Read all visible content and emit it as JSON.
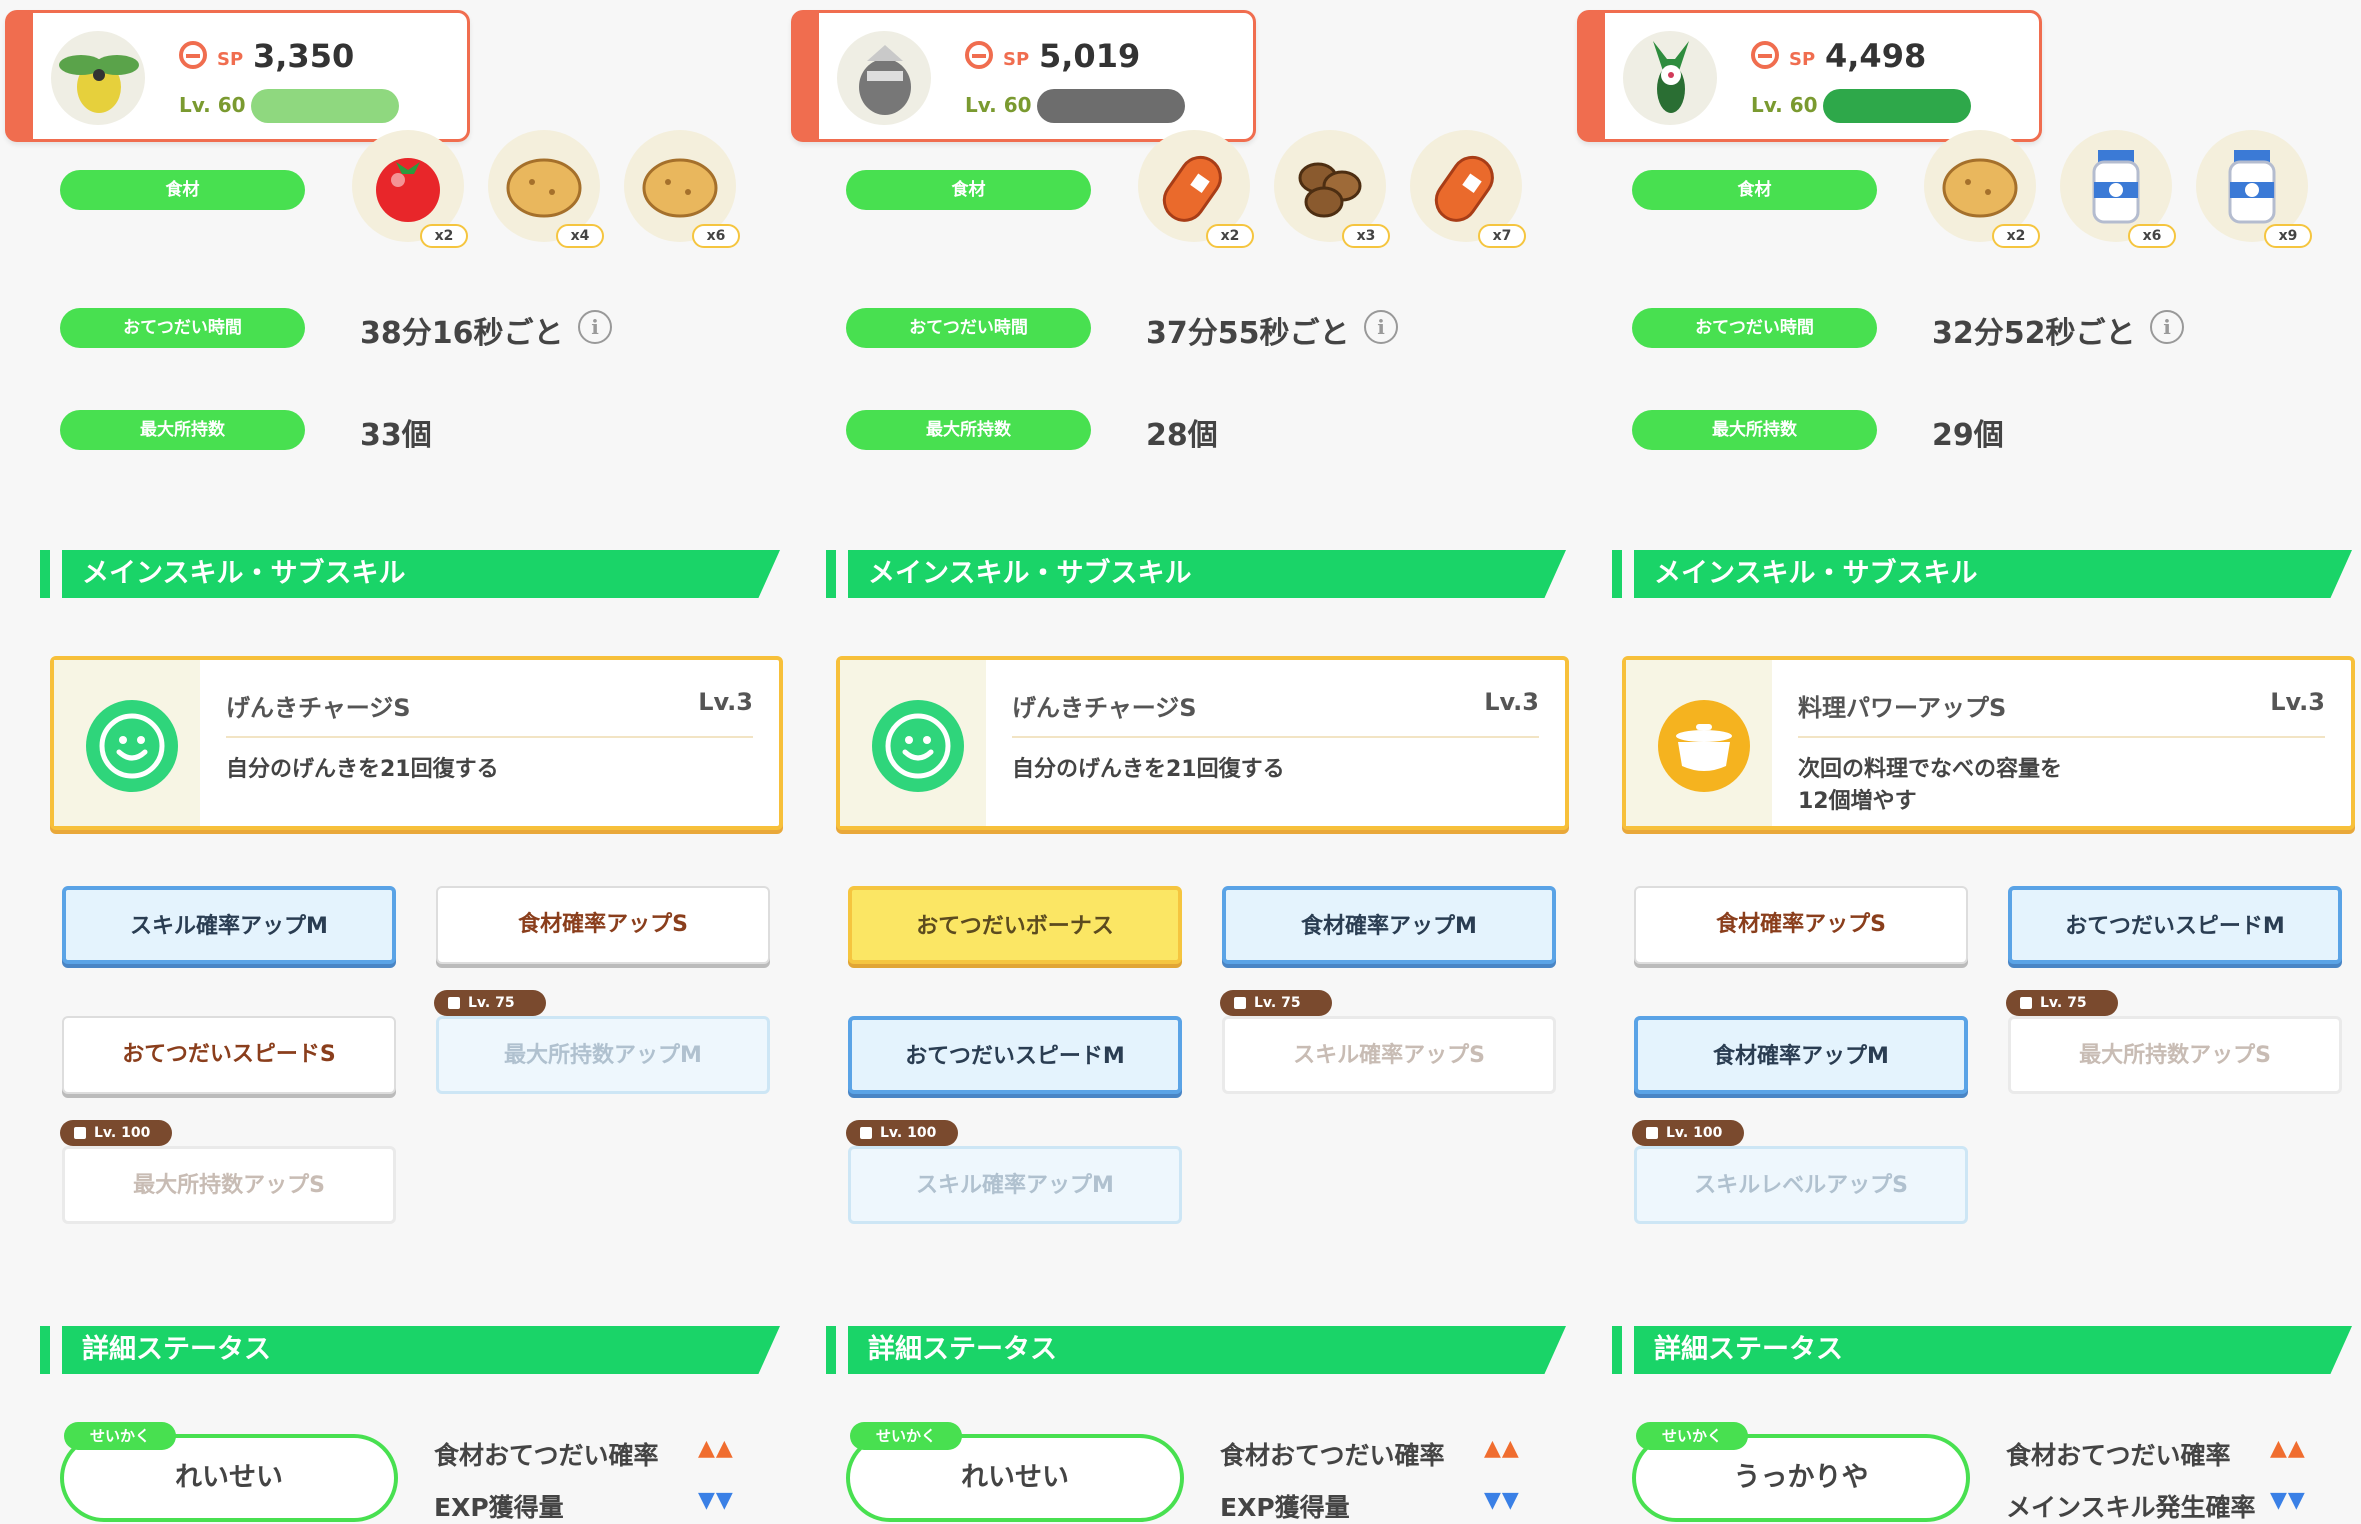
{
  "columns": [
    {
      "sp_tag": "SP",
      "sp": "3,350",
      "level": "Lv. 60",
      "level_bar_color": "#8fd87f",
      "pokemon": "weepinbell-like",
      "ingredients_label": "食材",
      "ingredients": [
        {
          "icon": "tomato-icon",
          "count": "x2"
        },
        {
          "icon": "potato-icon",
          "count": "x4"
        },
        {
          "icon": "potato-icon",
          "count": "x6"
        }
      ],
      "help_time_label": "おてつだい時間",
      "help_time": "38分16秒ごと",
      "max_label": "最大所持数",
      "max": "33個",
      "skill_header": "メインスキル・サブスキル",
      "skill_name": "げんきチャージS",
      "skill_level": "Lv.3",
      "skill_desc": "自分のげんきを21回復する",
      "skill_icon": "smile-icon",
      "skill_color": "#2fd57b",
      "subskills": [
        {
          "label": "スキル確率アップM",
          "style": "blue"
        },
        {
          "label": "食材確率アップS",
          "style": "white"
        },
        {
          "label": "おてつだいスピードS",
          "style": "white"
        },
        {
          "label": "最大所持数アップM",
          "style": "lock-b",
          "tag": "Lv. 75"
        },
        {
          "label": "最大所持数アップS",
          "style": "lock-w",
          "tag": "Lv. 100"
        }
      ],
      "detail_header": "詳細ステータス",
      "nature_tag": "せいかく",
      "nature": "れいせい",
      "stat_up": "食材おてつだい確率",
      "stat_down": "EXP獲得量",
      "up_arrows": "▲▲",
      "down_arrows": "▼▼"
    },
    {
      "sp_tag": "SP",
      "sp": "5,019",
      "level": "Lv. 60",
      "level_bar_color": "#6d6d6d",
      "pokemon": "aggron-like",
      "ingredients_label": "食材",
      "ingredients": [
        {
          "icon": "sausage-icon",
          "count": "x2"
        },
        {
          "icon": "beans-icon",
          "count": "x3"
        },
        {
          "icon": "sausage-icon",
          "count": "x7"
        }
      ],
      "help_time_label": "おてつだい時間",
      "help_time": "37分55秒ごと",
      "max_label": "最大所持数",
      "max": "28個",
      "skill_header": "メインスキル・サブスキル",
      "skill_name": "げんきチャージS",
      "skill_level": "Lv.3",
      "skill_desc": "自分のげんきを21回復する",
      "skill_icon": "smile-icon",
      "skill_color": "#2fd57b",
      "subskills": [
        {
          "label": "おてつだいボーナス",
          "style": "yellow"
        },
        {
          "label": "食材確率アップM",
          "style": "blue"
        },
        {
          "label": "おてつだいスピードM",
          "style": "blue"
        },
        {
          "label": "スキル確率アップS",
          "style": "lock-w",
          "tag": "Lv. 75"
        },
        {
          "label": "スキル確率アップM",
          "style": "lock-b",
          "tag": "Lv. 100"
        }
      ],
      "detail_header": "詳細ステータス",
      "nature_tag": "せいかく",
      "nature": "れいせい",
      "stat_up": "食材おてつだい確率",
      "stat_down": "EXP獲得量",
      "up_arrows": "▲▲",
      "down_arrows": "▼▼"
    },
    {
      "sp_tag": "SP",
      "sp": "4,498",
      "level": "Lv. 60",
      "level_bar_color": "#2ea84a",
      "pokemon": "meowscarada-like",
      "ingredients_label": "食材",
      "ingredients": [
        {
          "icon": "potato-icon",
          "count": "x2"
        },
        {
          "icon": "milk-icon",
          "count": "x6"
        },
        {
          "icon": "milk-icon",
          "count": "x9"
        }
      ],
      "help_time_label": "おてつだい時間",
      "help_time": "32分52秒ごと",
      "max_label": "最大所持数",
      "max": "29個",
      "skill_header": "メインスキル・サブスキル",
      "skill_name": "料理パワーアップS",
      "skill_level": "Lv.3",
      "skill_desc": "次回の料理でなべの容量を\n12個増やす",
      "skill_icon": "pot-icon",
      "skill_color": "#f5b31f",
      "subskills": [
        {
          "label": "食材確率アップS",
          "style": "white"
        },
        {
          "label": "おてつだいスピードM",
          "style": "blue"
        },
        {
          "label": "食材確率アップM",
          "style": "blue"
        },
        {
          "label": "最大所持数アップS",
          "style": "lock-w",
          "tag": "Lv. 75"
        },
        {
          "label": "スキルレベルアップS",
          "style": "lock-b",
          "tag": "Lv. 100"
        }
      ],
      "detail_header": "詳細ステータス",
      "nature_tag": "せいかく",
      "nature": "うっかりや",
      "stat_up": "食材おてつだい確率",
      "stat_down": "メインスキル発生確率",
      "up_arrows": "▲▲",
      "down_arrows": "▼▼"
    }
  ]
}
